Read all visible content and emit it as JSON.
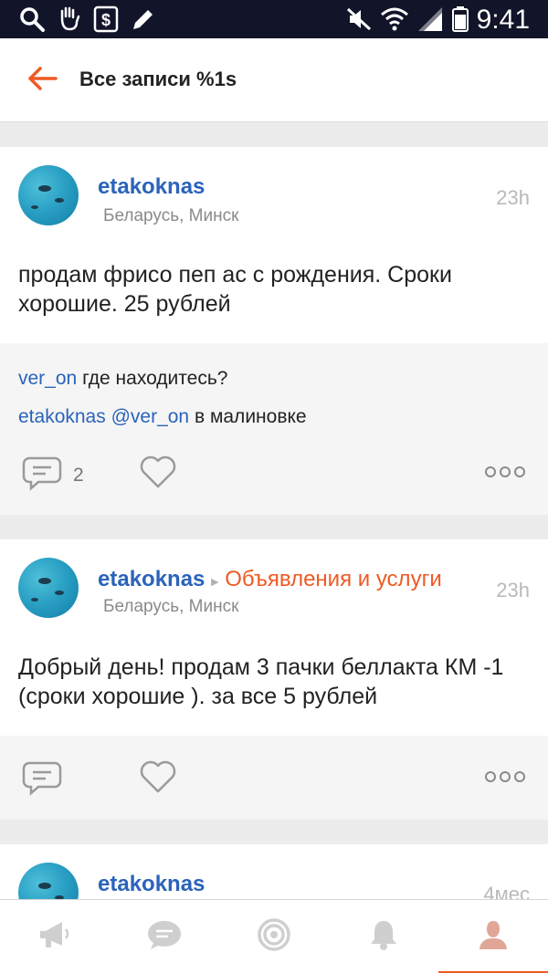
{
  "status_bar": {
    "time": "9:41",
    "icons": [
      "search-icon",
      "hand-icon",
      "dollar-icon",
      "pencil-icon",
      "mute-icon",
      "wifi-icon",
      "signal-icon",
      "battery-icon"
    ]
  },
  "app_bar": {
    "back_icon": "back-arrow-icon",
    "title": "Все записи %1s"
  },
  "colors": {
    "accent": "#ee5a24",
    "link": "#2a63bb",
    "muted": "#8a8a8a",
    "status_bar": "#12142a"
  },
  "posts": [
    {
      "author": "etakoknas",
      "group": "",
      "location": "Беларусь, Минск",
      "time": "23h",
      "text": "продам фрисо пеп ас с рождения. Сроки хорошие. 25 рублей",
      "comments": [
        {
          "user": "ver_on",
          "mention": "",
          "text": "где находитесь?"
        },
        {
          "user": "etakoknas",
          "mention": "@ver_on",
          "text": "в малиновке"
        }
      ],
      "comment_count": "2"
    },
    {
      "author": "etakoknas",
      "group": "Объявления и услуги",
      "location": "Беларусь, Минск",
      "time": "23h",
      "text": "Добрый день! продам 3 пачки беллакта КМ -1 (сроки хорошие ). за все 5 рублей",
      "comments": [],
      "comment_count": ""
    },
    {
      "author": "etakoknas",
      "time": "4мес"
    }
  ],
  "bottom_nav": [
    {
      "icon": "megaphone-icon",
      "active": false
    },
    {
      "icon": "chat-icon",
      "active": false
    },
    {
      "icon": "target-icon",
      "active": false
    },
    {
      "icon": "bell-icon",
      "active": false
    },
    {
      "icon": "profile-icon",
      "active": true
    }
  ]
}
